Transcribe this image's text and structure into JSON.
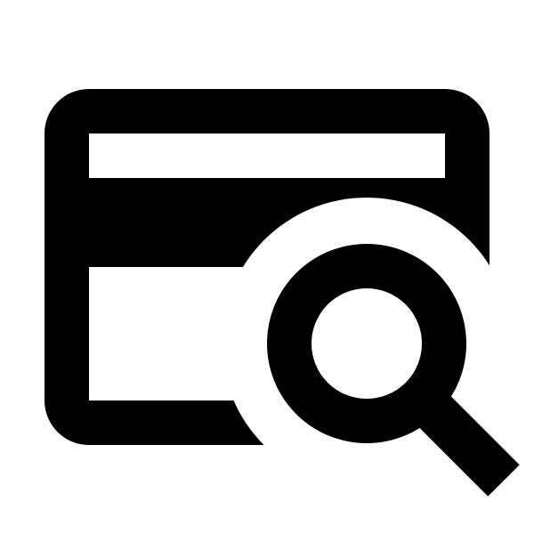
{
  "icon": {
    "name": "card-search-icon",
    "foreground": "#000000",
    "background": "#ffffff"
  }
}
